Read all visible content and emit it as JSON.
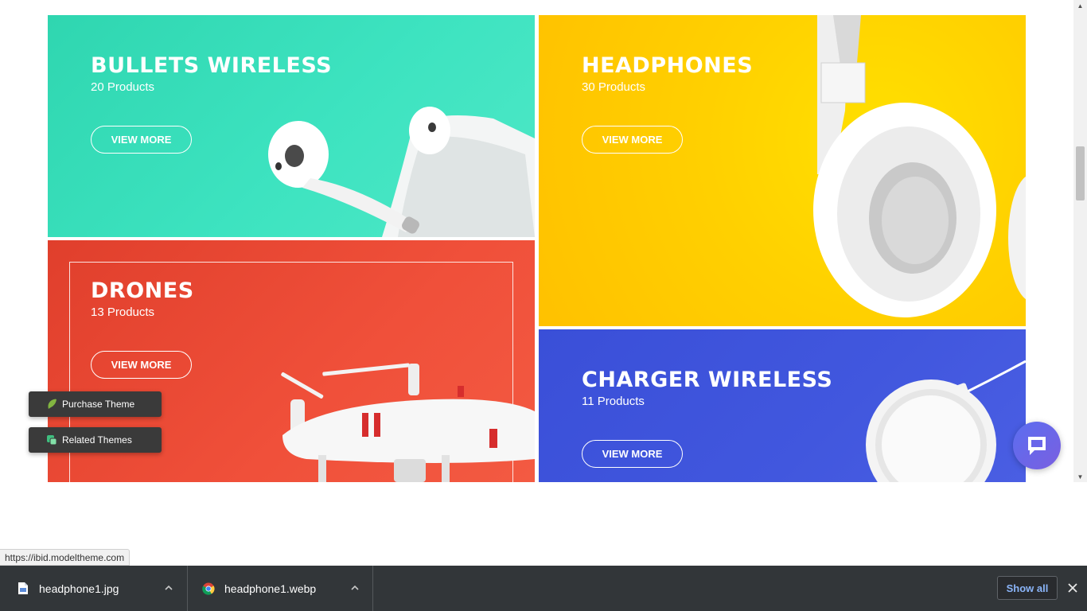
{
  "tiles": {
    "bullets": {
      "title": "BULLETS WIRELESS",
      "count": "20 Products",
      "button": "VIEW MORE"
    },
    "headphones": {
      "title": "HEADPHONES",
      "count": "30 Products",
      "button": "VIEW MORE"
    },
    "drones": {
      "title": "DRONES",
      "count": "13 Products",
      "button": "VIEW MORE"
    },
    "charger": {
      "title": "CHARGER WIRELESS",
      "count": "11 Products",
      "button": "VIEW MORE"
    }
  },
  "floating": {
    "purchase_label": "Purchase Theme",
    "related_label": "Related Themes"
  },
  "status_url": "https://ibid.modeltheme.com",
  "downloads": {
    "items": [
      {
        "name": "headphone1.jpg",
        "icon": "file-icon"
      },
      {
        "name": "headphone1.webp",
        "icon": "chrome-icon"
      }
    ],
    "show_all": "Show all"
  },
  "colors": {
    "teal": "#3de3c0",
    "yellow": "#ffd000",
    "red": "#f0503a",
    "blue": "#4157de",
    "download_bar": "#323639",
    "link_blue": "#8ab4f8"
  }
}
